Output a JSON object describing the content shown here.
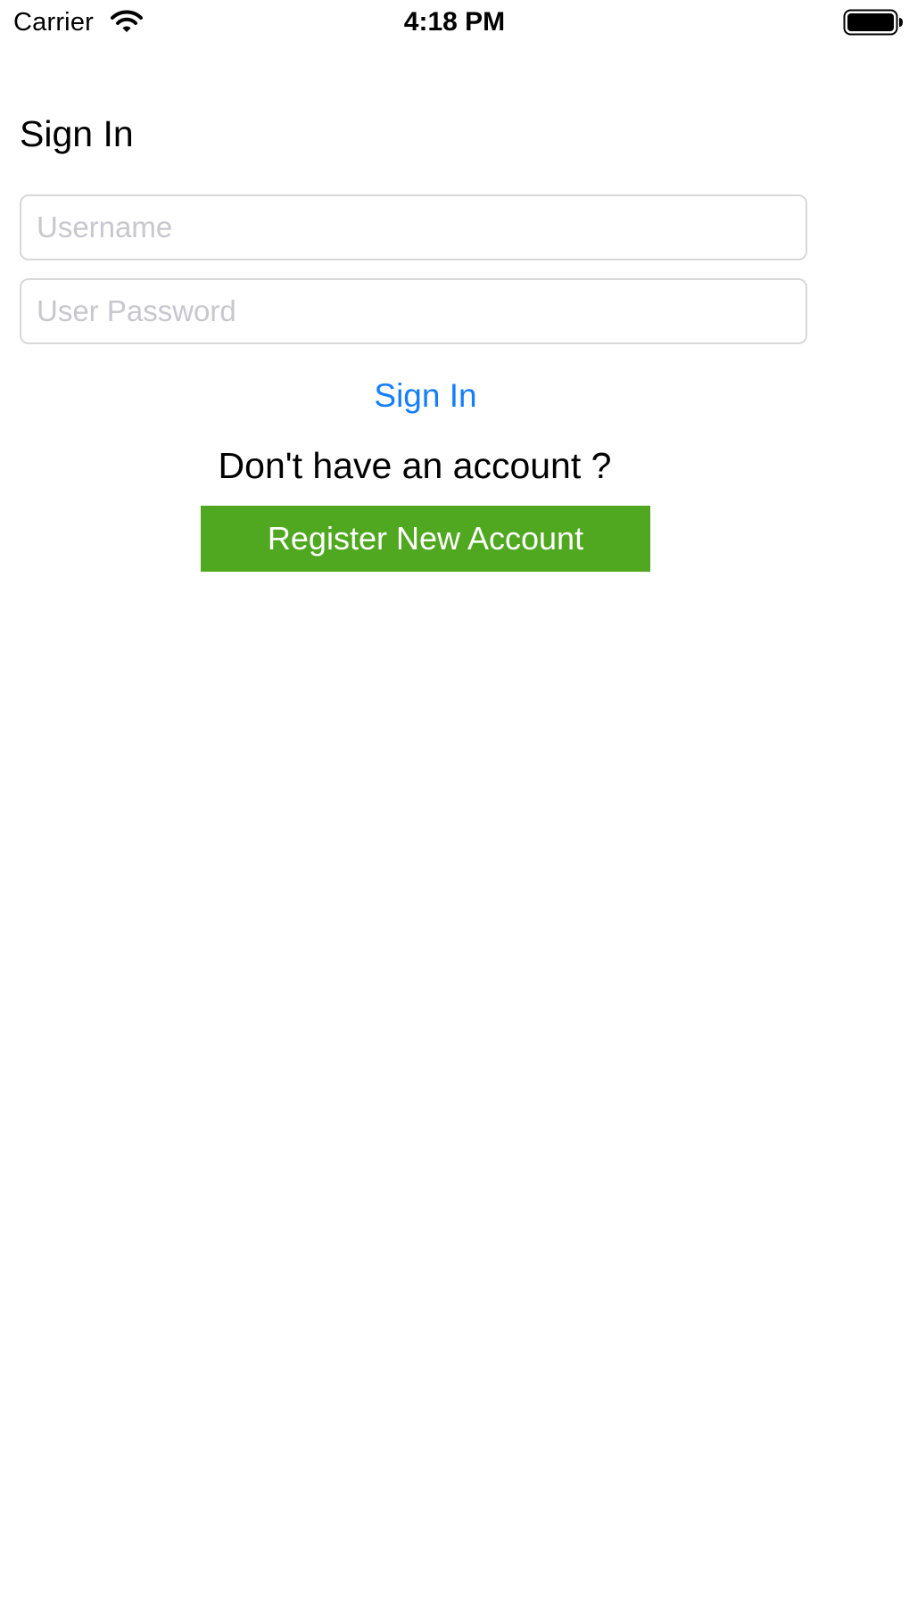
{
  "status_bar": {
    "carrier": "Carrier",
    "time": "4:18 PM",
    "icons": [
      "wifi-icon",
      "battery-icon"
    ]
  },
  "sign_in": {
    "title": "Sign In",
    "username_placeholder": "Username",
    "username_value": "",
    "password_placeholder": "User Password",
    "password_value": "",
    "sign_in_label": "Sign In",
    "no_account_text": "Don't have an account ?",
    "register_label": "Register New Account"
  },
  "colors": {
    "link_blue": "#157efb",
    "register_green": "#4fa81f",
    "placeholder_gray": "#c7c7cd",
    "field_border": "#d8d8d8"
  }
}
